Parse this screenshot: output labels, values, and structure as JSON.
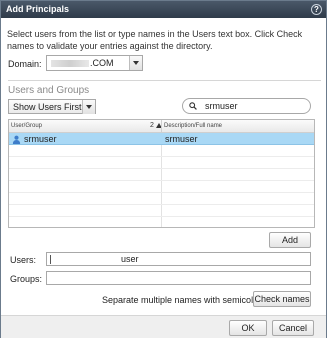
{
  "dialog": {
    "title": "Add Principals",
    "help_icon": "?",
    "description": "Select users from the list or type names in the Users text box. Click Check names to validate your entries against the directory."
  },
  "domain": {
    "label": "Domain:",
    "value": ".COM"
  },
  "users_and_groups": {
    "title": "Users and Groups",
    "show_filter": "Show Users First",
    "search_value": "srmuser",
    "columns": {
      "user_group": "User/Group",
      "sort_index": "2",
      "description": "Description/Full name"
    },
    "rows": [
      {
        "name": "srmuser",
        "description": "srmuser",
        "selected": true,
        "icon": "user-icon"
      }
    ]
  },
  "add_button": "Add",
  "users_field": {
    "label": "Users:",
    "value": "user"
  },
  "groups_field": {
    "label": "Groups:",
    "value": ""
  },
  "hint": "Separate multiple names with semicolons",
  "check_names_button": "Check names",
  "ok_button": "OK",
  "cancel_button": "Cancel",
  "colors": {
    "title_bar": "#3a4757",
    "selected_row": "#a9d8f5"
  }
}
